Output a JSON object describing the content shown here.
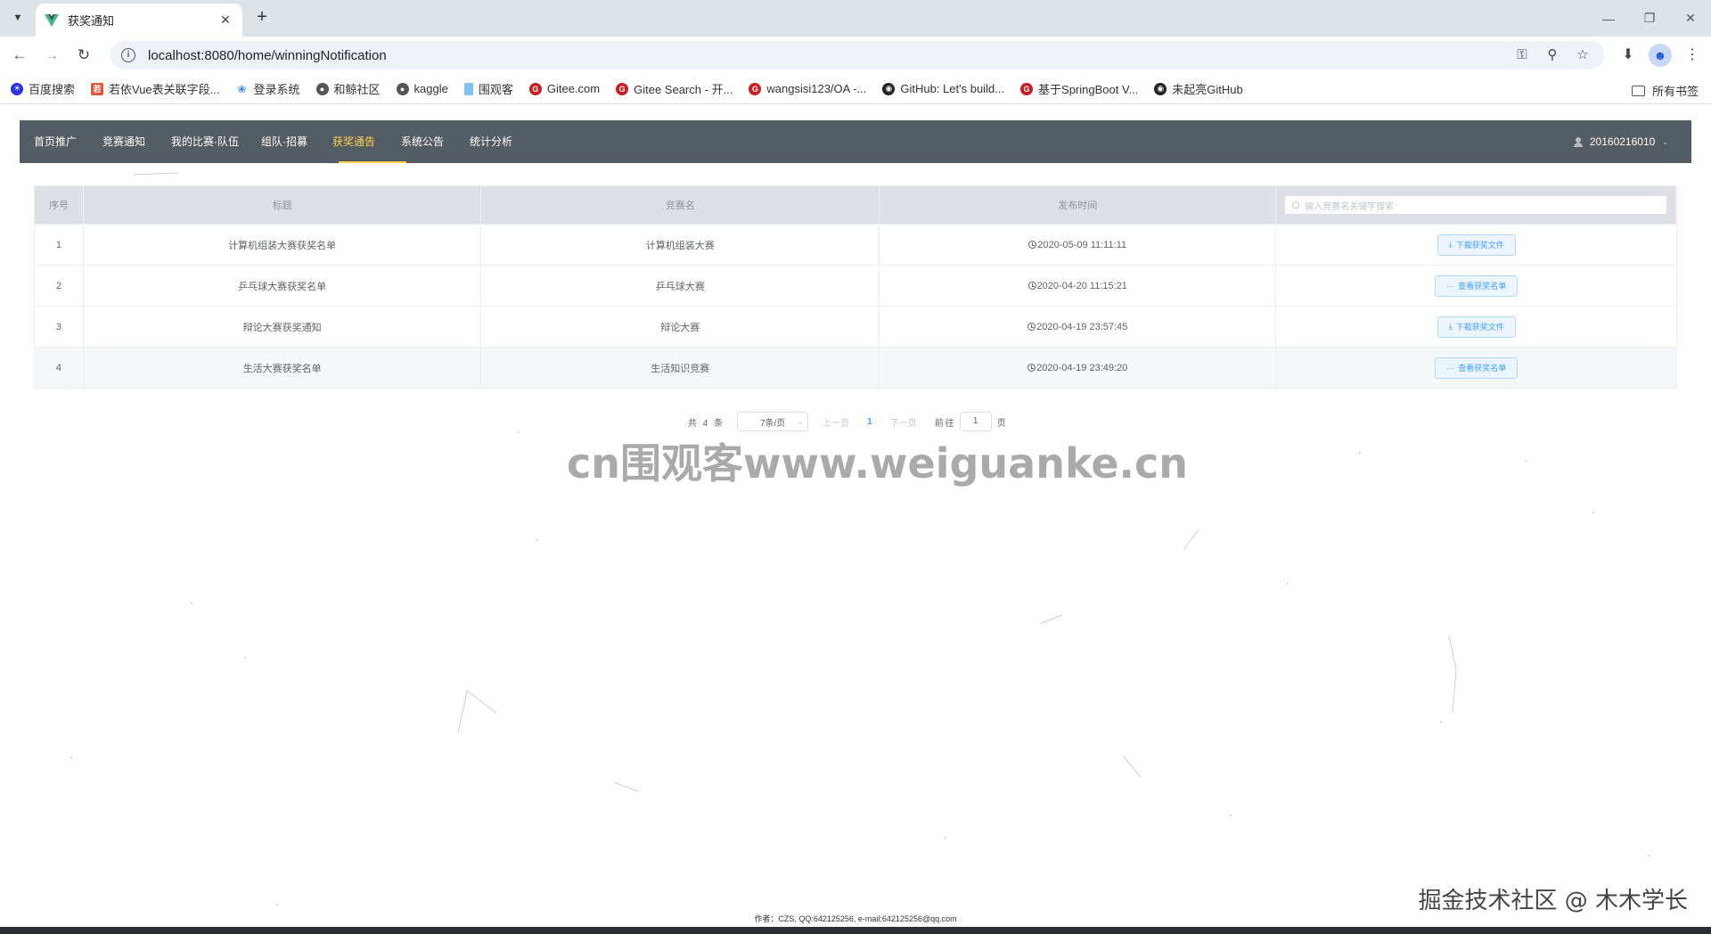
{
  "browser": {
    "tab_title": "获奖通知",
    "url": "localhost:8080/home/winningNotification",
    "bookmarks": [
      {
        "label": "百度搜索",
        "icon": "baidu-icon",
        "color": "#2932e1"
      },
      {
        "label": "若依Vue表关联字段...",
        "icon": "ruoyi-icon",
        "color": "#e6543c"
      },
      {
        "label": "登录系统",
        "icon": "leaf-icon",
        "color": "#3a8ee6"
      },
      {
        "label": "和鲸社区",
        "icon": "globe-icon",
        "color": "#555555"
      },
      {
        "label": "kaggle",
        "icon": "globe-icon",
        "color": "#555555"
      },
      {
        "label": "围观客",
        "icon": "page-icon",
        "color": "#7cc4f5"
      },
      {
        "label": "Gitee.com",
        "icon": "gitee-icon",
        "color": "#c71d23"
      },
      {
        "label": "Gitee Search - 开...",
        "icon": "gitee-icon",
        "color": "#c71d23"
      },
      {
        "label": "wangsisi123/OA -...",
        "icon": "gitee-icon",
        "color": "#c71d23"
      },
      {
        "label": "GitHub: Let's build...",
        "icon": "github-icon",
        "color": "#222222"
      },
      {
        "label": "基于SpringBoot V...",
        "icon": "gitee-icon",
        "color": "#c71d23"
      },
      {
        "label": "未起亮GitHub",
        "icon": "github-icon",
        "color": "#222222"
      }
    ],
    "all_bookmarks": "所有书签"
  },
  "nav": {
    "items": [
      "首页推广",
      "竞赛通知",
      "我的比赛·队伍",
      "组队·招募",
      "获奖通告",
      "系统公告",
      "统计分析"
    ],
    "active_index": 4,
    "username": "20160216010",
    "active_color": "#ffd04b",
    "bg_color": "#545c64"
  },
  "table": {
    "headers": {
      "index": "序号",
      "title": "标题",
      "competition": "竞赛名",
      "publish_time": "发布时间"
    },
    "search_placeholder": "输入竞赛名关键字搜索",
    "rows": [
      {
        "index": "1",
        "title": "计算机组装大赛获奖名单",
        "competition": "计算机组装大赛",
        "time": "2020-05-09 11:11:11",
        "action": "下载获奖文件",
        "action_icon": "download-icon"
      },
      {
        "index": "2",
        "title": "乒乓球大赛获奖名单",
        "competition": "乒乓球大赛",
        "time": "2020-04-20 11:15:21",
        "action": "查看获奖名单",
        "action_icon": "more-icon"
      },
      {
        "index": "3",
        "title": "辩论大赛获奖通知",
        "competition": "辩论大赛",
        "time": "2020-04-19 23:57:45",
        "action": "下载获奖文件",
        "action_icon": "download-icon"
      },
      {
        "index": "4",
        "title": "生活大赛获奖名单",
        "competition": "生活知识竞赛",
        "time": "2020-04-19 23:49:20",
        "action": "查看获奖名单",
        "action_icon": "more-icon"
      }
    ]
  },
  "pagination": {
    "total": "共 4 条",
    "page_size": "7条/页",
    "prev": "上一页",
    "current": "1",
    "next": "下一页",
    "goto_label": "前往",
    "goto_value": "1",
    "page_unit": "页"
  },
  "watermark": "cn围观客www.weiguanke.cn",
  "corner_watermark": "掘金技术社区 @ 木木学长",
  "footer": "作者：CZS, QQ:642125256, e-mail:642125256@qq.com"
}
